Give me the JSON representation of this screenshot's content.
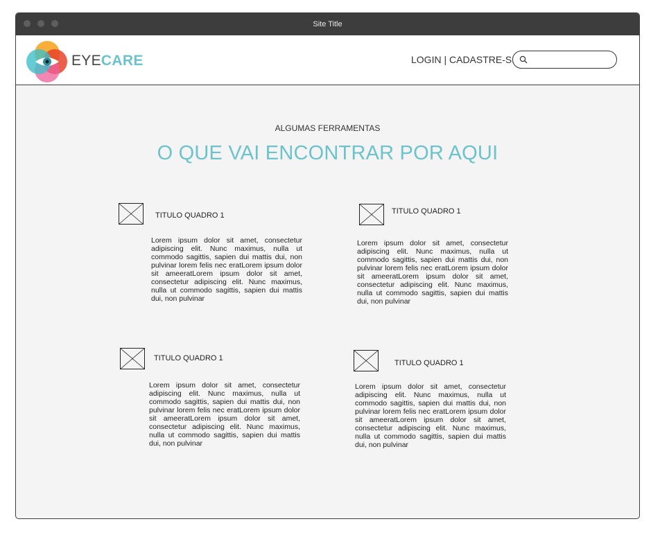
{
  "window": {
    "title": "Site Title"
  },
  "header": {
    "logo": {
      "text_eye": "EYE",
      "text_care": "CARE",
      "colors": [
        "#f6a623",
        "#e8442c",
        "#ee5f9b",
        "#3fbfc8"
      ]
    },
    "login_label": "LOGIN",
    "separator": "|",
    "signup_label": "CADASTRE-SE",
    "search": {
      "placeholder": "",
      "value": ""
    }
  },
  "main": {
    "subtitle": "ALGUMAS FERRAMENTAS",
    "headline": "O QUE VAI ENCONTRAR POR AQUI",
    "cards": [
      {
        "title": "TITULO QUADRO 1",
        "body": "Lorem ipsum dolor sit amet, consectetur adipiscing elit. Nunc maximus, nulla ut commodo sagittis, sapien dui mattis dui, non pulvinar lorem felis nec eratLorem ipsum dolor sit ameeratLorem ipsum dolor sit amet, consectetur adipiscing elit. Nunc maximus, nulla ut commodo sagittis, sapien dui mattis dui, non pulvinar"
      },
      {
        "title": "TITULO QUADRO 1",
        "body": "Lorem ipsum dolor sit amet, consectetur adipiscing elit. Nunc maximus, nulla ut commodo sagittis, sapien dui mattis dui, non pulvinar lorem felis nec eratLorem ipsum dolor sit ameeratLorem ipsum dolor sit amet, consectetur adipiscing elit. Nunc maximus, nulla ut commodo sagittis, sapien dui mattis dui, non pulvinar"
      },
      {
        "title": "TITULO QUADRO 1",
        "body": "Lorem ipsum dolor sit amet, consectetur adipiscing elit. Nunc maximus, nulla ut commodo sagittis, sapien dui mattis dui, non pulvinar lorem felis nec eratLorem ipsum dolor sit ameeratLorem ipsum dolor sit amet, consectetur adipiscing elit. Nunc maximus, nulla ut commodo sagittis, sapien dui mattis dui, non pulvinar"
      },
      {
        "title": "TITULO QUADRO 1",
        "body": "Lorem ipsum dolor sit amet, consectetur adipiscing elit. Nunc maximus, nulla ut commodo sagittis, sapien dui mattis dui, non pulvinar lorem felis nec eratLorem ipsum dolor sit ameeratLorem ipsum dolor sit amet, consectetur adipiscing elit. Nunc maximus, nulla ut commodo sagittis, sapien dui mattis dui, non pulvinar"
      }
    ]
  },
  "colors": {
    "accent": "#6cc3cc",
    "titlebar": "#3d3d3d",
    "content_bg": "#f4f4f4"
  }
}
